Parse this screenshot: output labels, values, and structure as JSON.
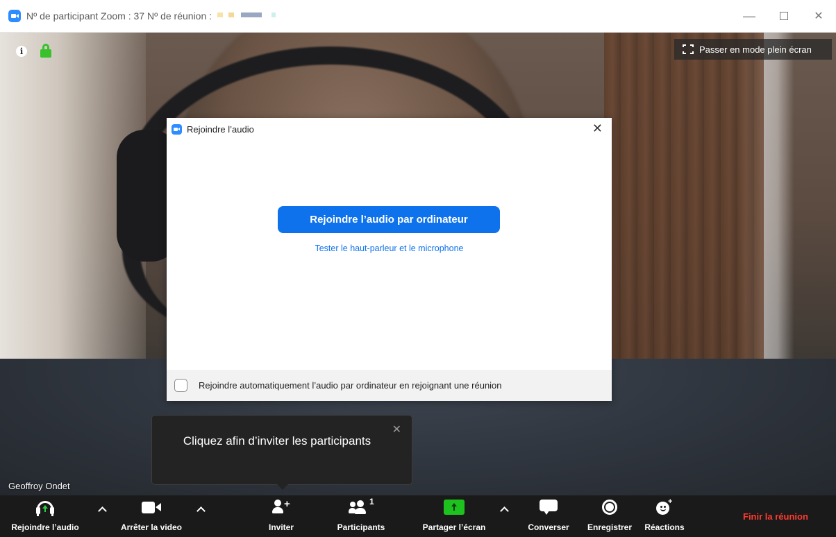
{
  "window": {
    "title": "Nº de participant Zoom : 37   Nº de réunion :",
    "minimize": "—",
    "close": "✕"
  },
  "colors": {
    "zoom_blue": "#2d8cff",
    "button_blue": "#0e72ed",
    "share_green": "#1ec21e",
    "end_red": "#ff3b30",
    "lock_green": "#38c12b"
  },
  "video": {
    "fullscreen_label": "Passer en mode plein écran",
    "participant_name": "Geoffroy Ondet",
    "info_icon": "i"
  },
  "dialog": {
    "title": "Rejoindre l’audio",
    "close": "✕",
    "primary_button": "Rejoindre l’audio par ordinateur",
    "test_link": "Tester le haut-parleur et le microphone",
    "auto_join_label": "Rejoindre automatiquement l’audio par ordinateur en rejoignant une réunion",
    "auto_join_checked": false
  },
  "tooltip": {
    "text": "Cliquez afin d’inviter les participants",
    "close": "✕"
  },
  "toolbar": {
    "join_audio": "Rejoindre l’audio",
    "stop_video": "Arrêter la video",
    "invite": "Inviter",
    "participants": "Participants",
    "participants_count": "1",
    "share_screen": "Partager l’écran",
    "chat": "Converser",
    "record": "Enregistrer",
    "reactions": "Réactions",
    "end_meeting": "Finir la réunion",
    "invite_plus": "+",
    "reactions_plus": "+"
  },
  "icons": [
    "zoom-logo-icon",
    "info-icon",
    "lock-icon",
    "fullscreen-icon",
    "headphone-icon",
    "video-camera-icon",
    "add-person-icon",
    "people-icon",
    "share-screen-icon",
    "chat-bubble-icon",
    "record-icon",
    "smiley-icon",
    "chevron-up-icon"
  ]
}
